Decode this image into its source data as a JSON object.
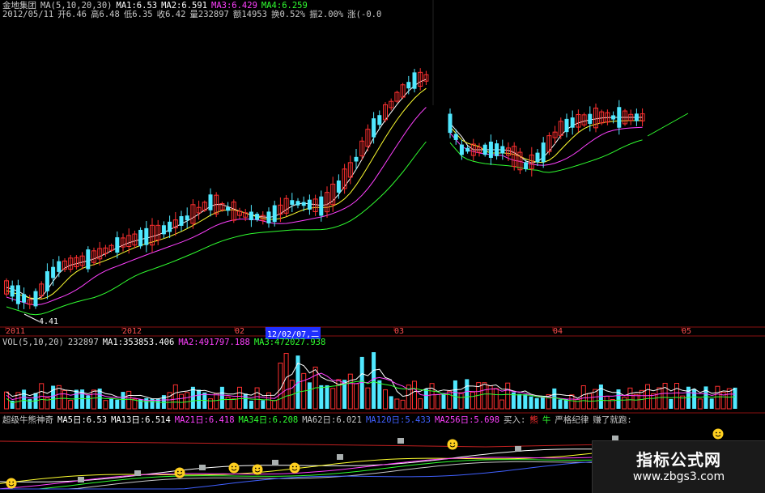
{
  "header": {
    "stock_name": "金地集团",
    "ma_params": "MA(5,10,20,30)",
    "ma1": "MA1:6.53",
    "ma2": "MA2:6.591",
    "ma3": "MA3:6.429",
    "ma4": "MA4:6.259",
    "date": "2012/05/11",
    "open": "开6.46",
    "high": "高6.48",
    "low": "低6.35",
    "close": "收6.42",
    "volume": "量232897",
    "amount": "额14953",
    "turnover": "换0.52%",
    "amplitude": "振2.00%",
    "change": "涨(-0.0"
  },
  "price_chart": {
    "low_marker": "4.41"
  },
  "time_axis": {
    "labels": [
      "2011",
      "2012",
      "02",
      "03",
      "04",
      "05"
    ],
    "cursor_date": "12/02/07,二"
  },
  "volume_panel": {
    "params": "VOL(5,10,20)",
    "current": "232897",
    "ma1": "MA1:353853.406",
    "ma2": "MA2:491797.188",
    "ma3": "MA3:472027.938"
  },
  "indicator_panel": {
    "name": "超级牛熊神奇",
    "ma5": "MA5日:6.53",
    "ma13": "MA13日:6.514",
    "ma21": "MA21日:6.418",
    "ma34": "MA34日:6.208",
    "ma62": "MA62日:6.021",
    "ma_hidden": "MA120日:5.433",
    "ma256": "MA256日:5.698",
    "buy": "买入:",
    "bear": "熊",
    "bull": "牛",
    "discipline": "严格纪律",
    "profit": "赚了就跑:"
  },
  "watermark": {
    "title": "指标公式网",
    "url": "www.zbgs3.com"
  },
  "colors": {
    "up": "#ff3030",
    "down": "#50e8ff",
    "ma1": "#ffffff",
    "ma2": "#ffff30",
    "ma3": "#ff40ff",
    "ma4": "#30ff30",
    "smiley": "#ffd020"
  }
}
